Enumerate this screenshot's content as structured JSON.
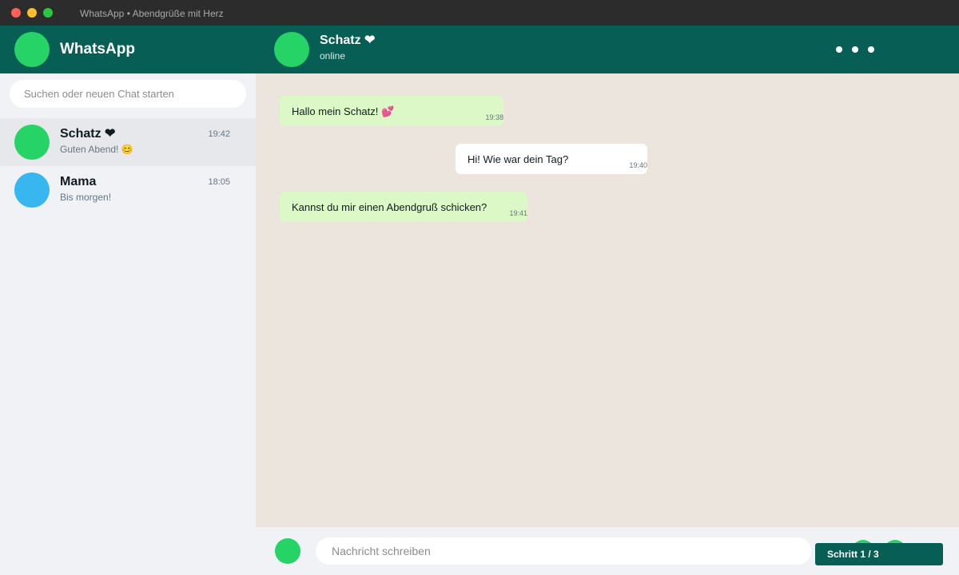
{
  "window": {
    "title": "WhatsApp • Abendgrüße mit Herz"
  },
  "sidebar": {
    "app_name": "WhatsApp",
    "search_placeholder": "Suchen oder neuen Chat starten",
    "chats": [
      {
        "name": "Schatz ❤",
        "time": "19:42",
        "preview": "Guten Abend! 😊",
        "avatar_color": "#25d366",
        "active": true
      },
      {
        "name": "Mama",
        "time": "18:05",
        "preview": "Bis morgen!",
        "avatar_color": "#38b6f0",
        "active": false
      }
    ]
  },
  "chat": {
    "contact_name": "Schatz ❤",
    "status": "online",
    "menu_icon": "more-dots-icon",
    "messages": [
      {
        "text": "Hallo mein Schatz! 💕",
        "time": "19:38",
        "direction": "outgoing"
      },
      {
        "text": "Hi! Wie war dein Tag?",
        "time": "19:40",
        "direction": "incoming"
      },
      {
        "text": "Kannst du mir einen Abendgruß schicken?",
        "time": "19:41",
        "direction": "outgoing"
      }
    ]
  },
  "composer": {
    "placeholder": "Nachricht schreiben"
  },
  "step": {
    "label": "Schritt 1 / 3"
  },
  "colors": {
    "header": "#075e54",
    "accent": "#25d366",
    "outgoing_bubble": "#dcf8c6",
    "incoming_bubble": "#ffffff",
    "chat_background": "#ece5de"
  }
}
